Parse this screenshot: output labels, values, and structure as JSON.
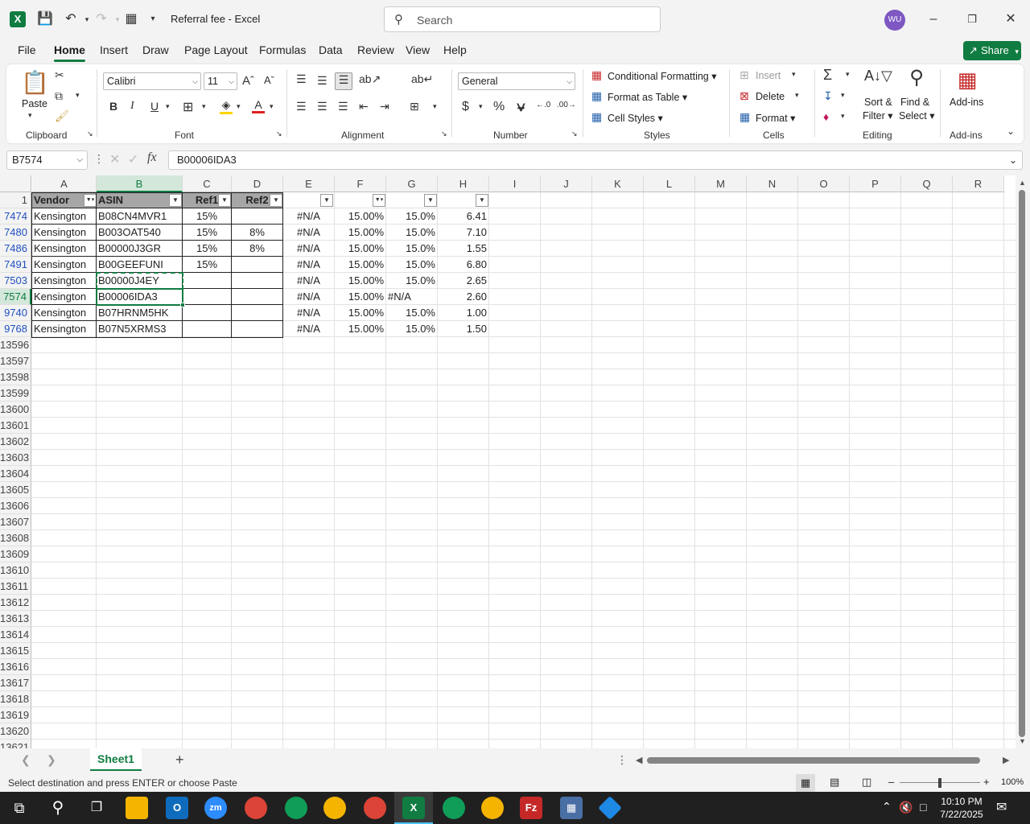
{
  "titlebar": {
    "app_name": "Referral fee  -  Excel",
    "search_placeholder": "Search",
    "avatar_initials": "WU"
  },
  "menu": {
    "tabs": [
      "File",
      "Home",
      "Insert",
      "Draw",
      "Page Layout",
      "Formulas",
      "Data",
      "Review",
      "View",
      "Help"
    ],
    "share_label": "Share"
  },
  "ribbon": {
    "clipboard": {
      "paste": "Paste",
      "label": "Clipboard"
    },
    "font": {
      "name": "Calibri",
      "size": "11",
      "label": "Font"
    },
    "alignment": {
      "label": "Alignment"
    },
    "number": {
      "format": "General",
      "label": "Number"
    },
    "styles": {
      "conditional": "Conditional Formatting",
      "format_table": "Format as Table",
      "cell_styles": "Cell Styles",
      "label": "Styles"
    },
    "cells": {
      "insert": "Insert",
      "delete": "Delete",
      "format": "Format",
      "label": "Cells"
    },
    "editing": {
      "sort_line1": "Sort &",
      "sort_line2": "Filter",
      "find_line1": "Find &",
      "find_line2": "Select",
      "label": "Editing"
    },
    "addins": {
      "button": "Add-ins",
      "label": "Add-ins"
    }
  },
  "formula_bar": {
    "name_box": "B7574",
    "fx": "fx",
    "content": "B00006IDA3"
  },
  "sheet": {
    "columns": [
      "A",
      "B",
      "C",
      "D",
      "E",
      "F",
      "G",
      "H",
      "I",
      "J",
      "K",
      "L",
      "M",
      "N",
      "O",
      "P",
      "Q",
      "R"
    ],
    "header_row": {
      "num": "1",
      "A": "Vendor",
      "B": "ASIN",
      "C": "Ref1",
      "D": "Ref2"
    },
    "rows": [
      {
        "num": "7474",
        "A": "Kensington",
        "B": "B08CN4MVR1",
        "C": "15%",
        "D": "",
        "E": "#N/A",
        "F": "15.00%",
        "G": "15.0%",
        "H": "6.41"
      },
      {
        "num": "7480",
        "A": "Kensington",
        "B": "B003OAT540",
        "C": "15%",
        "D": "8%",
        "E": "#N/A",
        "F": "15.00%",
        "G": "15.0%",
        "H": "7.10"
      },
      {
        "num": "7486",
        "A": "Kensington",
        "B": "B00000J3GR",
        "C": "15%",
        "D": "8%",
        "E": "#N/A",
        "F": "15.00%",
        "G": "15.0%",
        "H": "1.55"
      },
      {
        "num": "7491",
        "A": "Kensington",
        "B": "B00GEEFUNI",
        "C": "15%",
        "D": "",
        "E": "#N/A",
        "F": "15.00%",
        "G": "15.0%",
        "H": "6.80"
      },
      {
        "num": "7503",
        "A": "Kensington",
        "B": "B00000J4EY",
        "C": "",
        "D": "",
        "E": "#N/A",
        "F": "15.00%",
        "G": "15.0%",
        "H": "2.65"
      },
      {
        "num": "7574",
        "A": "Kensington",
        "B": "B00006IDA3",
        "C": "",
        "D": "",
        "E": "#N/A",
        "F": "15.00%",
        "G": "#N/A",
        "H": "2.60"
      },
      {
        "num": "9740",
        "A": "Kensington",
        "B": "B07HRNM5HK",
        "C": "",
        "D": "",
        "E": "#N/A",
        "F": "15.00%",
        "G": "15.0%",
        "H": "1.00"
      },
      {
        "num": "9768",
        "A": "Kensington",
        "B": "B07N5XRMS3",
        "C": "",
        "D": "",
        "E": "#N/A",
        "F": "15.00%",
        "G": "15.0%",
        "H": "1.50"
      }
    ],
    "empty_rows": [
      "13596",
      "13597",
      "13598",
      "13599",
      "13600",
      "13601",
      "13602",
      "13603",
      "13604",
      "13605",
      "13606",
      "13607",
      "13608",
      "13609",
      "13610",
      "13611",
      "13612",
      "13613",
      "13614",
      "13615",
      "13616",
      "13617",
      "13618",
      "13619",
      "13620",
      "13621"
    ]
  },
  "sheet_tabs": {
    "active": "Sheet1",
    "add": "+"
  },
  "status": {
    "message": "Select destination and press ENTER or choose Paste",
    "zoom": "100%"
  },
  "taskbar": {
    "time": "10:10 PM",
    "date": "7/22/2025"
  },
  "colors": {
    "accent": "#107c41",
    "header_fill": "#a6a6a6",
    "filtered_row_num": "#1f4fbf"
  }
}
